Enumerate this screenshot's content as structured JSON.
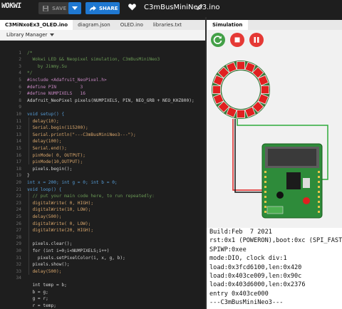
{
  "topbar": {
    "logo": "WOKWI",
    "save_label": "SAVE",
    "share_label": "SHARE",
    "project_title": "C3mBusMiniNeo3.ino",
    "heart_icon": "heart-icon",
    "pencil_icon": "pencil-icon"
  },
  "tabs": [
    {
      "label": "C3MiNxoEx3_OLED.ino",
      "active": true
    },
    {
      "label": "diagram.json",
      "active": false
    },
    {
      "label": "OLED.ino",
      "active": false
    },
    {
      "label": "libraries.txt",
      "active": false
    }
  ],
  "library_manager": {
    "label": "Library Manager"
  },
  "editor": {
    "line_numbers": [
      "",
      "1",
      "2",
      "3",
      "4",
      "5",
      "6",
      "7",
      "8",
      "9",
      "10",
      "11",
      "12",
      "13",
      "14",
      "15",
      "16",
      "17",
      "18",
      "19",
      "20",
      "21",
      "22",
      "23",
      "24",
      "25",
      "26",
      "27",
      "28",
      "29",
      "30",
      "31",
      "32",
      "33",
      "34"
    ],
    "lines": [
      "",
      "/*",
      "  Wokwi LED && Neopixel simulation, C3mBusMiniNeo3",
      "    by Jimmy.Su",
      "*/",
      "#include <Adafruit_NeoPixel.h>",
      "#define PIN         3",
      "#define NUMPIXELS   16",
      "Adafruit_NeoPixel pixels(NUMPIXELS, PIN, NEO_GRB + NEO_KHZ800);",
      "",
      "void setup() {",
      "  delay(10);",
      "  Serial.begin(115200);",
      "  Serial.println(\"---C3mBusMiniNeo3---\");",
      "  delay(100);",
      "  Serial.end();",
      "  pinMode( 0, OUTPUT);",
      "  pinMode(10,OUTPUT);",
      "  pixels.begin();",
      "}",
      "int x = 200; int g = 0; int b = 0;",
      "void loop() {",
      "  // put your main code here, to run repeatedly:",
      "  digitalWrite( 0, HIGH);",
      "  digitalWrite(10, LOW);",
      "  delay(500);",
      "  digitalWrite( 0, LOW);",
      "  digitalWrite(20, HIGH);",
      "",
      "  pixels.clear();",
      "  for (int i=0;i<NUMPIXELS;i++)",
      "    pixels.setPixelColor(i, x, g, b);",
      "  pixels.show();",
      "  delay(500);",
      "",
      "  int temp = b;",
      "  b = g;",
      "  g = r;",
      "  r = temp;"
    ]
  },
  "simulation": {
    "tab_label": "Simulation",
    "controls": [
      {
        "name": "restart-button",
        "color": "#43a047"
      },
      {
        "name": "stop-button",
        "color": "#e53935"
      },
      {
        "name": "pause-button",
        "color": "#e53935"
      }
    ],
    "neopixel_count": 16,
    "pixel_color": "#e02020",
    "board_color": "#2e8b3a"
  },
  "terminal": {
    "lines": [
      "Build:Feb  7 2021",
      "rst:0x1 (POWERON),boot:0xc (SPI_FAST_",
      "SPIWP:0xee",
      "mode:DIO, clock div:1",
      "load:0x3fcd6100,len:0x420",
      "load:0x403ce009,len:0x90c",
      "load:0x403d6000,len:0x2376",
      "entry 0x403ce000",
      "---C3mBusMiniNeo3---"
    ]
  }
}
